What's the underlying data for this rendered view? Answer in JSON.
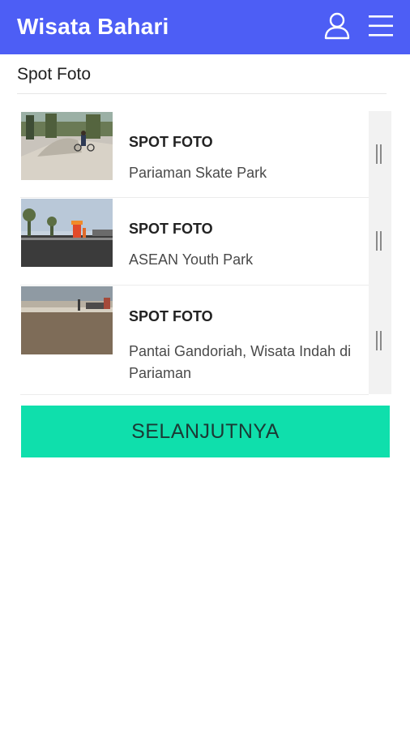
{
  "header": {
    "title": "Wisata Bahari",
    "user_icon": "user-icon",
    "menu_icon": "hamburger-menu-icon",
    "background": "#4d5ef5"
  },
  "section": {
    "title": "Spot Foto"
  },
  "list": {
    "items": [
      {
        "tag": "SPOT FOTO",
        "name": "Pariaman Skate Park",
        "image": "skate-park-photo"
      },
      {
        "tag": "SPOT FOTO",
        "name": "ASEAN Youth Park",
        "image": "youth-park-photo"
      },
      {
        "tag": "SPOT FOTO",
        "name": "Pantai Gandoriah, Wisata Indah di Pariaman",
        "image": "beach-photo"
      }
    ]
  },
  "actions": {
    "next_label": "SELANJUTNYA",
    "next_color": "#0fdfac"
  }
}
